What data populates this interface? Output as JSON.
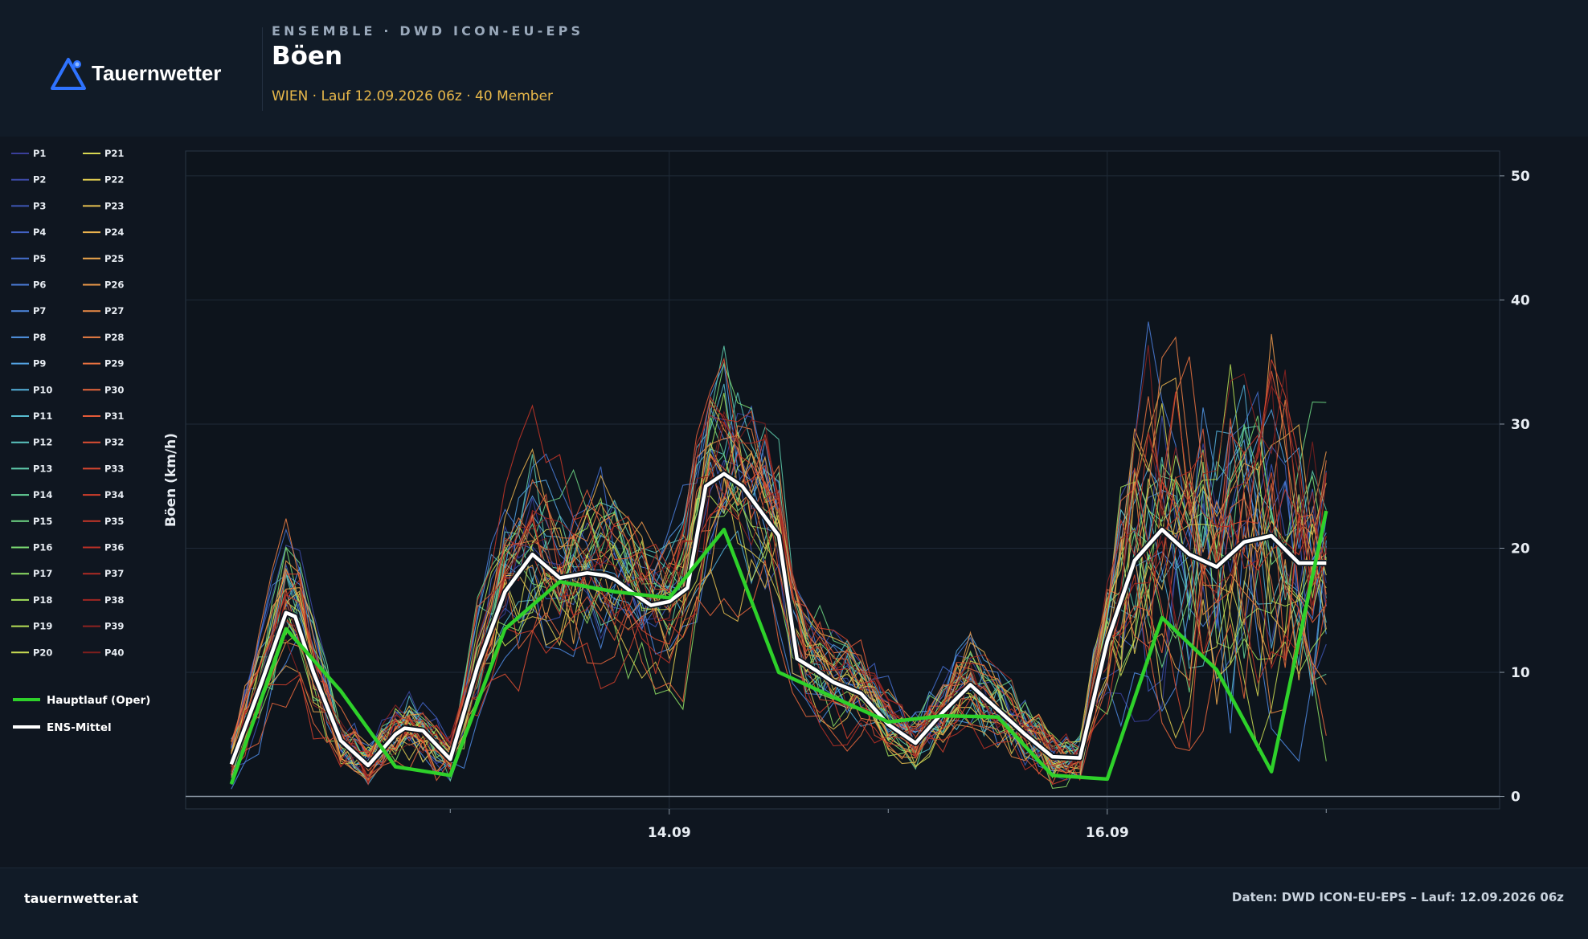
{
  "brand": {
    "name": "Tauernwetter",
    "accent": "#2f73ff"
  },
  "header": {
    "kicker": "ENSEMBLE · DWD ICON-EU-EPS",
    "title": "Böen",
    "subtitle": "WIEN · Lauf 12.09.2026 06z · 40 Member"
  },
  "footer": {
    "left": "tauernwetter.at",
    "right": "Daten: DWD ICON-EU-EPS – Lauf: 12.09.2026 06z"
  },
  "chart_data": {
    "type": "line",
    "title": "Böen",
    "ylabel": "Böen (km/h)",
    "xlabel": "",
    "ylim": [
      -1,
      52
    ],
    "yticks": [
      0,
      10,
      20,
      30,
      40,
      50
    ],
    "y_axis_side": "right",
    "grid": true,
    "x_unit": "hours since 12.09.2026 00z",
    "x_range": [
      -5,
      139
    ],
    "xticks": [
      {
        "x": 48,
        "label": "14.09"
      },
      {
        "x": 96,
        "label": "16.09"
      }
    ],
    "xminorticks": [
      24,
      72,
      120
    ],
    "legend_position": "left",
    "member_count": 40,
    "member_prefix": "P",
    "member_colors": [
      "#3a3f9a",
      "#3d4aa8",
      "#3f56b5",
      "#4262c2",
      "#456fce",
      "#4b7cd9",
      "#4f89e2",
      "#5296e6",
      "#54a4e4",
      "#55b1dc",
      "#57bcd0",
      "#5ac5c0",
      "#5fcdad",
      "#66d298",
      "#6fd784",
      "#7cdb72",
      "#8ede64",
      "#a2e05a",
      "#b7df55",
      "#c9dc52",
      "#d8d752",
      "#e1cd51",
      "#e7c150",
      "#ebb34e",
      "#eda64c",
      "#ee994a",
      "#ee8c47",
      "#ed7f44",
      "#eb7240",
      "#e8663c",
      "#e45a38",
      "#de4f33",
      "#d8462f",
      "#d03e2b",
      "#c63628",
      "#bb3026",
      "#ae2b24",
      "#9f2622",
      "#8f2220",
      "#7e1e1d"
    ],
    "ens_mean": {
      "name": "ENS-Mittel",
      "color": "#ffffff",
      "x": [
        0,
        3,
        6,
        7,
        9,
        12,
        15,
        18,
        19,
        21,
        24,
        27,
        30,
        33,
        36,
        39,
        41,
        42,
        44,
        46,
        48,
        50,
        52,
        54,
        56,
        58,
        60,
        62,
        64,
        66,
        69,
        72,
        75,
        78,
        81,
        84,
        87,
        90,
        93,
        96,
        99,
        102,
        105,
        108,
        111,
        114,
        117,
        120
      ],
      "y": [
        2.6,
        8.5,
        14.8,
        14.5,
        10,
        4.5,
        2.5,
        5,
        5.5,
        5.3,
        3,
        10.5,
        16.5,
        19.5,
        17.6,
        18,
        17.8,
        17.5,
        16.4,
        15.4,
        15.7,
        16.8,
        25,
        26,
        25,
        23,
        21,
        11.1,
        10.2,
        9.2,
        8.3,
        5.8,
        4.3,
        6.8,
        9,
        7,
        5,
        3.2,
        3.1,
        12.5,
        19,
        21.5,
        19.5,
        18.5,
        20.5,
        21,
        18.8,
        18.8
      ]
    },
    "operational": {
      "name": "Hauptlauf (Oper)",
      "color": "#2ed12a",
      "x": [
        0,
        6,
        12,
        18,
        24,
        30,
        36,
        42,
        48,
        54,
        60,
        66,
        72,
        78,
        84,
        90,
        96,
        102,
        108,
        114,
        120
      ],
      "y": [
        1,
        13.5,
        8.5,
        2.4,
        1.7,
        13.5,
        17.3,
        16.5,
        16,
        21.5,
        10,
        8,
        6,
        6.5,
        6.4,
        1.7,
        1.4,
        14.4,
        10.2,
        2,
        23
      ]
    }
  }
}
